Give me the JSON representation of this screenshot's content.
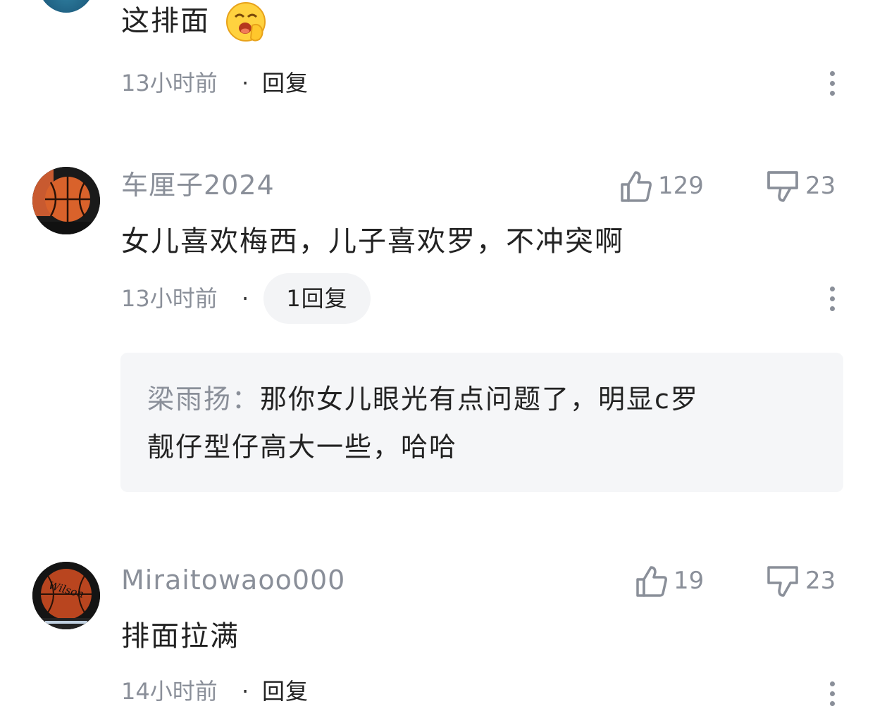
{
  "comments": [
    {
      "text": "这排面",
      "time": "13小时前",
      "dot": "·",
      "reply_label": "回复"
    },
    {
      "username": "车厘子2024",
      "likes": "129",
      "dislikes": "23",
      "text": "女儿喜欢梅西，儿子喜欢罗，不冲突啊",
      "time": "13小时前",
      "dot": "·",
      "reply_count_label": "1回复",
      "reply": {
        "author": "梁雨扬：",
        "text_line1": "那你女儿眼光有点问题了，明显c罗",
        "text_line2": "靓仔型仔高大一些，哈哈"
      }
    },
    {
      "username": "Miraitowaoo000",
      "likes": "19",
      "dislikes": "23",
      "text": "排面拉满",
      "time": "14小时前",
      "dot": "·",
      "reply_label": "回复"
    }
  ],
  "icons": {
    "emoji": "smiling-face-with-hand-over-mouth",
    "like": "thumbs-up-icon",
    "dislike": "thumbs-down-icon",
    "more": "more-vertical-icon",
    "basketball_avatar_1": "basketball",
    "basketball_avatar_2": "wilson-basketball"
  },
  "colors": {
    "meta_gray": "#8a8f99",
    "text_dark": "#222222",
    "reply_bg": "#f5f6f8",
    "pill_bg": "#f3f4f6"
  }
}
